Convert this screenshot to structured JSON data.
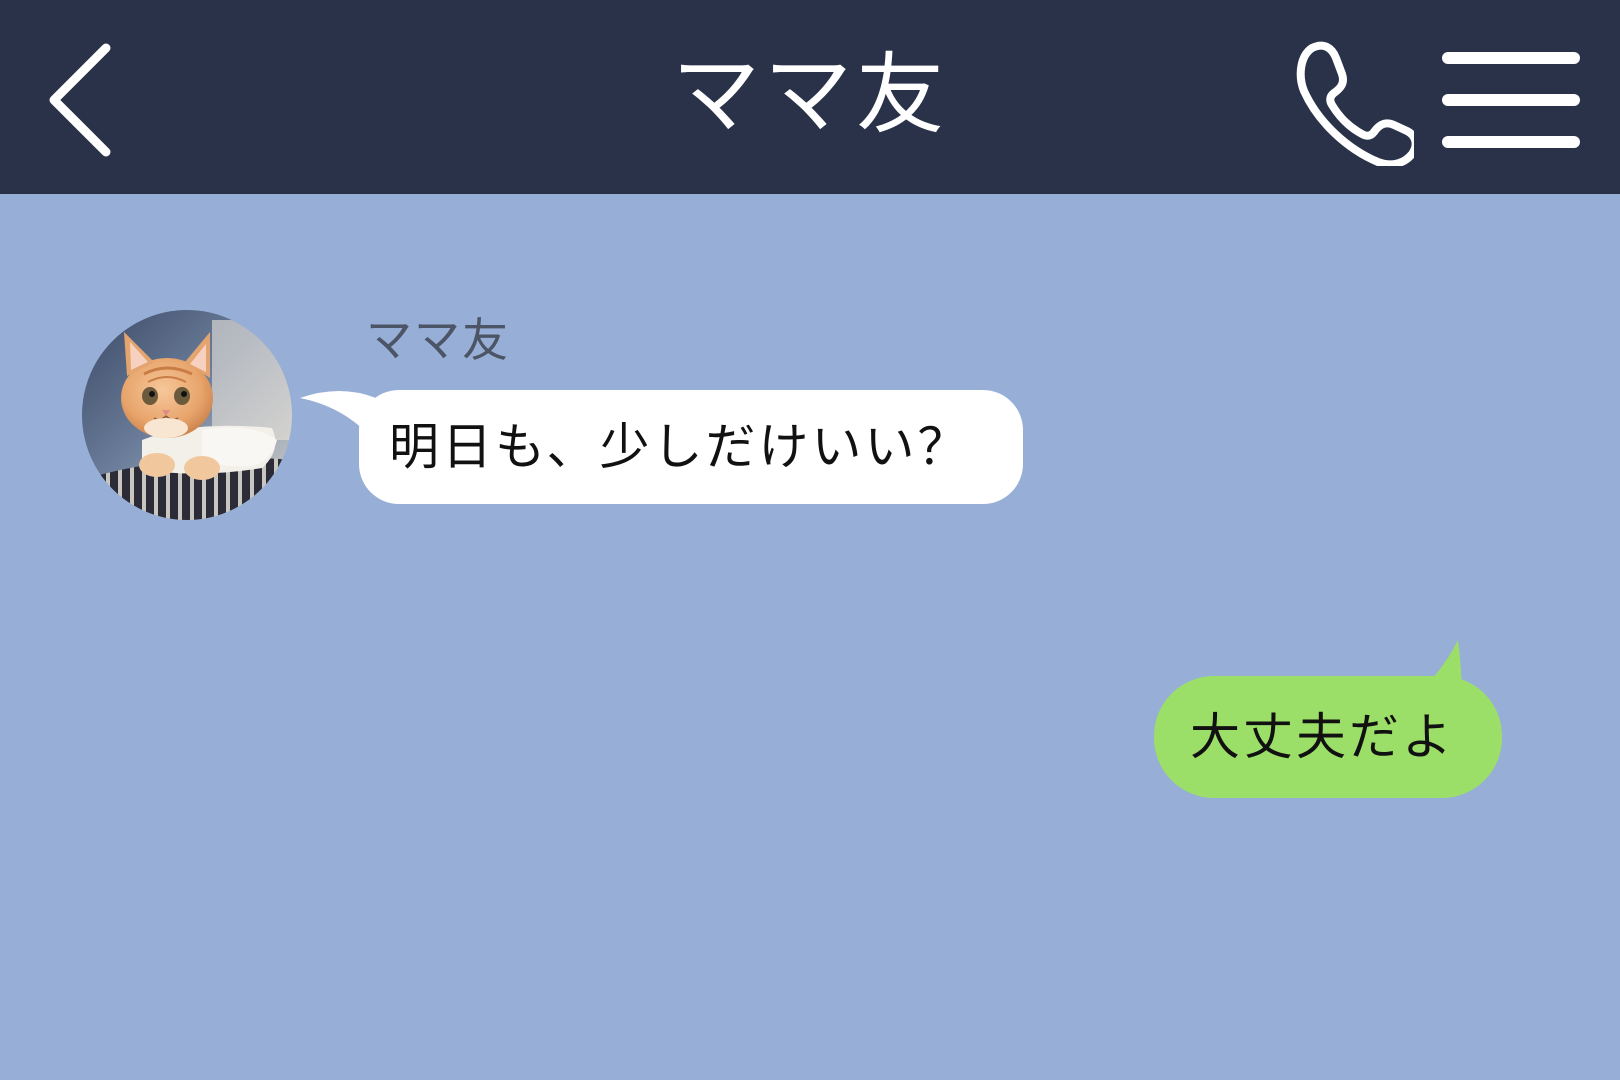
{
  "header": {
    "title": "ママ友",
    "back_icon": "chevron-left-icon",
    "call_icon": "phone-icon",
    "menu_icon": "hamburger-menu-icon"
  },
  "chat": {
    "incoming": {
      "sender_name": "ママ友",
      "avatar_icon": "kitten-avatar",
      "text": "明日も、少しだけいい？"
    },
    "outgoing": {
      "text": "大丈夫だよ"
    }
  },
  "colors": {
    "header_bg": "#2a3249",
    "chat_bg": "#97aed7",
    "incoming_bubble": "#ffffff",
    "outgoing_bubble": "#9cdf68",
    "sender_name": "#4c5566"
  }
}
